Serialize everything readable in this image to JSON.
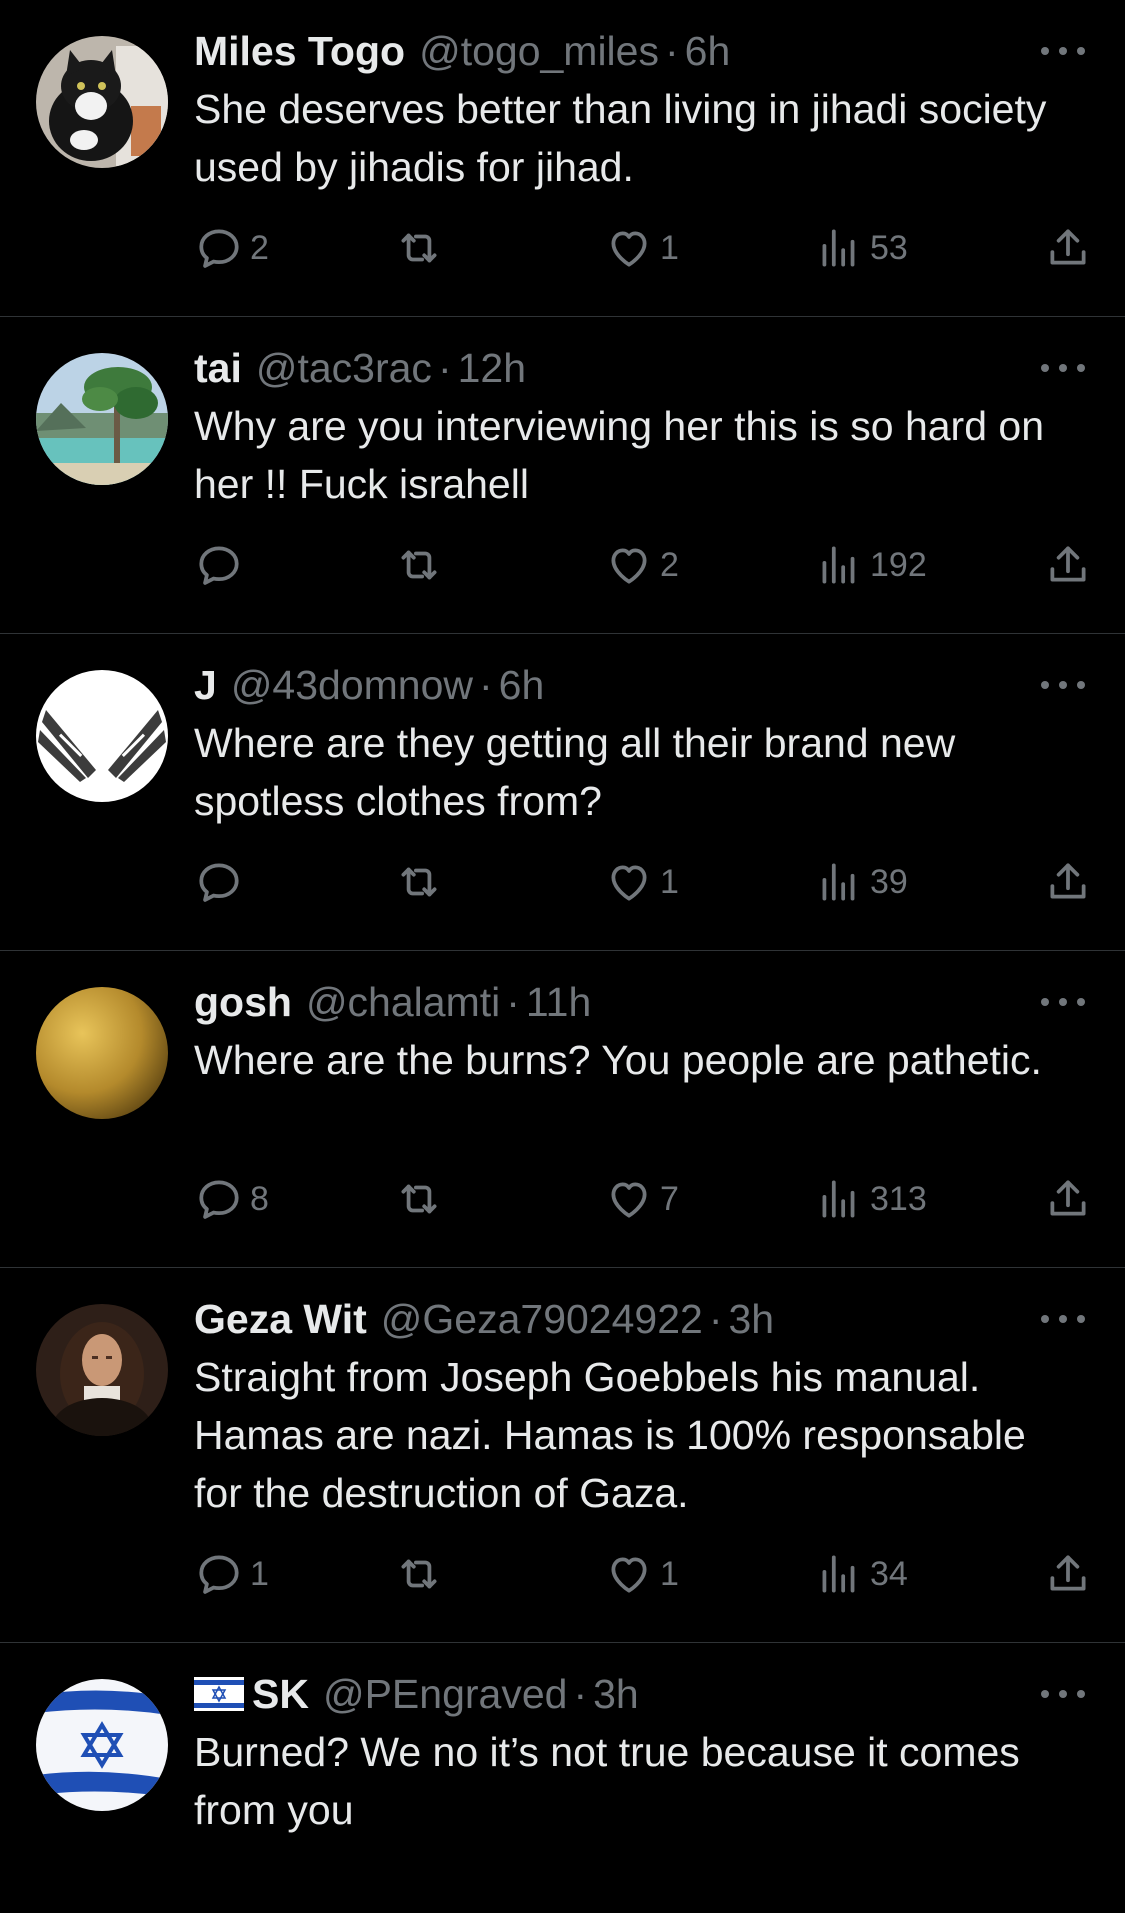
{
  "tweets": [
    {
      "name": "Miles Togo",
      "handle": "@togo_miles",
      "dot": "·",
      "time": "6h",
      "text": "She deserves better than living in jihadi society used by jihadis for jihad.",
      "replies": "2",
      "retweets": "",
      "likes": "1",
      "views": "53",
      "avatar": "cat-avatar"
    },
    {
      "name": "tai",
      "handle": "@tac3rac",
      "dot": "·",
      "time": "12h",
      "text": "Why are you interviewing her this is so hard on her !! Fuck israhell",
      "replies": "",
      "retweets": "",
      "likes": "2",
      "views": "192",
      "avatar": "landscape-avatar"
    },
    {
      "name": "J",
      "handle": "@43domnow",
      "dot": "·",
      "time": "6h",
      "text": "Where are they getting all their brand new spotless clothes from?",
      "replies": "",
      "retweets": "",
      "likes": "1",
      "views": "39",
      "avatar": "wings-avatar"
    },
    {
      "name": "gosh",
      "handle": "@chalamti",
      "dot": "·",
      "time": "11h",
      "text": "Where are the burns? You people are pathetic.",
      "replies": "8",
      "retweets": "",
      "likes": "7",
      "views": "313",
      "avatar": "gold-avatar"
    },
    {
      "name": "Geza Wit",
      "handle": "@Geza79024922",
      "dot": "·",
      "time": "3h",
      "text": "Straight from Joseph Goebbels his manual. Hamas are nazi. Hamas is 100% responsable for the destruction of Gaza.",
      "replies": "1",
      "retweets": "",
      "likes": "1",
      "views": "34",
      "avatar": "portrait-avatar"
    },
    {
      "name": "SK",
      "handle": "@PEngraved",
      "dot": "·",
      "time": "3h",
      "text": "Burned? We no it’s not true because it comes from you",
      "avatar": "israel-flag-avatar"
    }
  ],
  "colors": {
    "background": "#000000",
    "text": "#e7e9ea",
    "muted": "#71767b",
    "divider": "#2f3336"
  },
  "icons": {
    "reply": "reply-icon",
    "retweet": "retweet-icon",
    "like": "heart-icon",
    "views": "views-icon",
    "share": "share-icon",
    "more": "more-icon"
  }
}
